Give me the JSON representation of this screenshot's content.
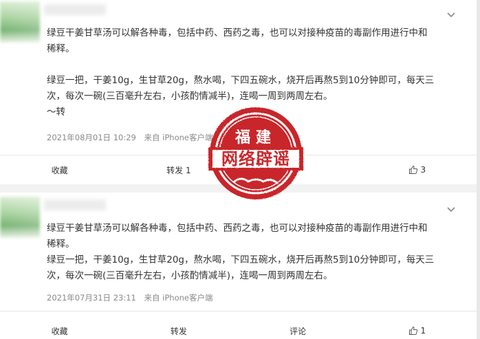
{
  "posts": [
    {
      "lines": [
        "绿豆干姜甘草汤可以解各种毒，包括中药、西药之毒，也可以对接种疫苗的毒副作用进行中和",
        "稀释。",
        "",
        "绿豆一把，干姜10g，生甘草20g，熬水喝，下四五碗水，烧开后再熬5到10分钟即可，每天三",
        "次，每次一碗(三百毫升左右，小孩酌情减半)，连喝一周到两周左右。",
        "～转"
      ],
      "timestamp": "2021年08月01日 10:29",
      "source": "来自 iPhone客户端",
      "actions": {
        "collect": "收藏",
        "repost": "转发 1",
        "comment": "",
        "like": "3"
      }
    },
    {
      "lines": [
        "绿豆干姜甘草汤可以解各种毒，包括中药、西药之毒，也可以对接种疫苗的毒副作用进行中和",
        "稀释。",
        "绿豆一把，干姜10g，生甘草20g，熬水喝，下四五碗水，烧开后再熬5到10分钟即可，每天三",
        "次，每次一碗(三百毫升左右，小孩酌情减半)，连喝一周到两周左右。"
      ],
      "timestamp": "2021年07月31日 23:11",
      "source": "来自 iPhone客户端",
      "actions": {
        "collect": "收藏",
        "repost": "转发",
        "comment": "评论",
        "like": "1"
      }
    }
  ],
  "stamp": {
    "top_text": "福建",
    "main_text": "网络辟谣",
    "color": "#c8252c"
  },
  "icons": {
    "expand": "chevron-down-icon",
    "like": "thumbs-up-icon"
  }
}
